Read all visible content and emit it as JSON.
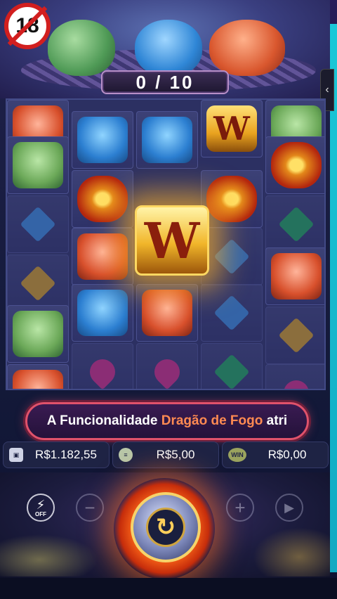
{
  "age_rating": "18",
  "progress_counter": "0 / 10",
  "side_tab_icon": "‹",
  "grid": {
    "cells": [
      {
        "symbol": "red-dragon-icon",
        "glyph": ""
      },
      {
        "symbol": "blue-dragon-icon",
        "glyph": ""
      },
      {
        "symbol": "blue-dragon-icon",
        "glyph": ""
      },
      {
        "symbol": "wild-icon",
        "glyph": "W"
      },
      {
        "symbol": "green-frog-icon",
        "glyph": ""
      }
    ],
    "wild_glyph": "W"
  },
  "banner": {
    "prefix": "A Funcionalidade ",
    "highlight": "Dragão de Fogo",
    "suffix": " atri"
  },
  "stats": {
    "balance": "R$1.182,55",
    "bet": "R$5,00",
    "win_label": "WIN",
    "win": "R$0,00"
  },
  "controls": {
    "turbo_label": "OFF",
    "minus": "−",
    "plus": "+",
    "autoplay": "▶"
  }
}
